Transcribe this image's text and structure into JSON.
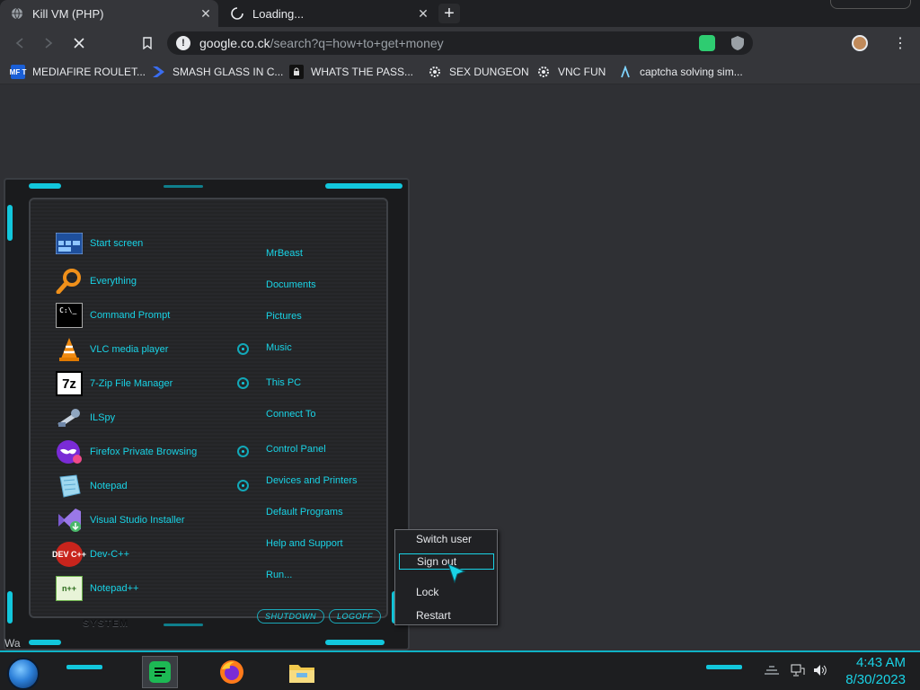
{
  "tabs": [
    {
      "title": "Kill VM (PHP)",
      "close": "✕"
    },
    {
      "title": "Loading...",
      "close": "✕"
    }
  ],
  "new_tab": "+",
  "toolbar": {
    "url_host": "google.co.ck",
    "url_path": "/search?q=how+to+get+money",
    "menu": "⋮"
  },
  "bookmarks": [
    {
      "label": "MEDIAFIRE ROULET...",
      "icon_text": "MF T",
      "icon": "mediafire-icon"
    },
    {
      "label": "SMASH GLASS IN C...",
      "icon_text": "",
      "icon": "chevron-logo-icon"
    },
    {
      "label": "WHATS THE PASS...",
      "icon_text": "",
      "icon": "lock-site-icon"
    },
    {
      "label": "SEX DUNGEON",
      "icon_text": "",
      "icon": "gear-site-icon"
    },
    {
      "label": "VNC FUN",
      "icon_text": "",
      "icon": "gear-site-icon"
    },
    {
      "label": "captcha solving sim...",
      "icon_text": "",
      "icon": "lambda-icon"
    }
  ],
  "start_menu": {
    "programs": [
      {
        "label": "Start screen",
        "icon": "start-screen-icon",
        "icon_text": ""
      },
      {
        "label": "Everything",
        "icon": "magnifier-icon",
        "icon_text": ""
      },
      {
        "label": "Command Prompt",
        "icon": "cmd-icon",
        "icon_text": "C:\\_"
      },
      {
        "label": "VLC media player",
        "icon": "vlc-cone-icon",
        "icon_text": ""
      },
      {
        "label": "7-Zip File Manager",
        "icon": "7zip-icon",
        "icon_text": "7z"
      },
      {
        "label": "ILSpy",
        "icon": "ilspy-icon",
        "icon_text": ""
      },
      {
        "label": "Firefox Private Browsing",
        "icon": "private-mask-icon",
        "icon_text": ""
      },
      {
        "label": "Notepad",
        "icon": "notepad-icon",
        "icon_text": ""
      },
      {
        "label": "Visual Studio Installer",
        "icon": "vs-installer-icon",
        "icon_text": ""
      },
      {
        "label": "Dev-C++",
        "icon": "devcpp-icon",
        "icon_text": "DEV C++"
      },
      {
        "label": "Notepad++",
        "icon": "notepadpp-icon",
        "icon_text": "n++"
      }
    ],
    "places": [
      {
        "label": "MrBeast",
        "has_arrow": false
      },
      {
        "label": "Documents",
        "has_arrow": false
      },
      {
        "label": "Pictures",
        "has_arrow": false
      },
      {
        "label": "Music",
        "has_arrow": true
      },
      {
        "label": "This PC",
        "has_arrow": true
      },
      {
        "label": "Connect To",
        "has_arrow": false
      },
      {
        "label": "Control Panel",
        "has_arrow": true
      },
      {
        "label": "Devices and Printers",
        "has_arrow": true
      },
      {
        "label": "Default Programs",
        "has_arrow": false
      },
      {
        "label": "Help and Support",
        "has_arrow": false
      },
      {
        "label": "Run...",
        "has_arrow": false
      }
    ],
    "system_label": "SYSTEM",
    "shutdown": "SHUTDOWN",
    "logoff": "LOGOFF"
  },
  "power_menu": {
    "items": [
      "Switch user",
      "Sign out",
      "Lock",
      "Restart"
    ],
    "selected": "Sign out"
  },
  "bottom_text": "Wa",
  "clock": {
    "time": "4:43 AM",
    "date": "8/30/2023"
  },
  "colors": {
    "accent": "#19d3e6",
    "chrome_bg": "#35363a",
    "page_bg": "#2f3034"
  }
}
